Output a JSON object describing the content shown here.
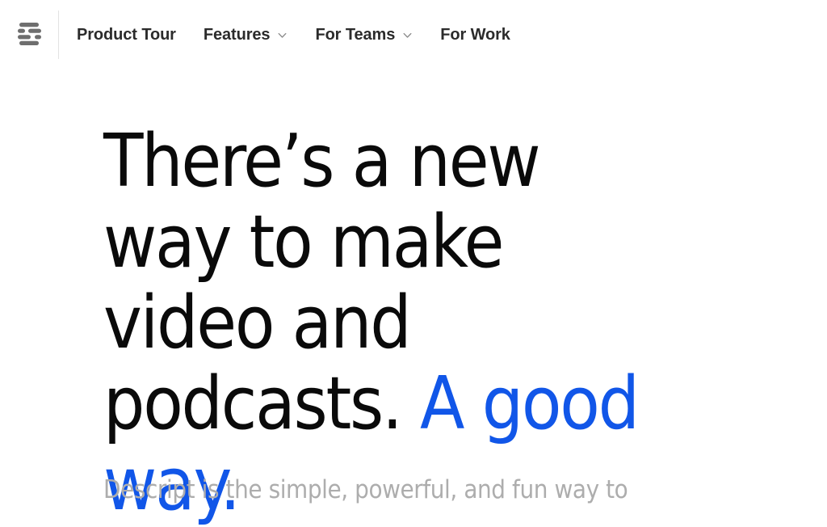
{
  "header": {
    "logo": {
      "icon": "descript-logo-icon",
      "alt": "Descript"
    },
    "nav_items": [
      {
        "label": "Product Tour",
        "has_dropdown": false
      },
      {
        "label": "Features",
        "has_dropdown": true
      },
      {
        "label": "For Teams",
        "has_dropdown": true
      },
      {
        "label": "For Work",
        "has_dropdown": false
      }
    ]
  },
  "hero": {
    "headline_part1": "There’s a new way to make video and podcasts. ",
    "headline_accent": "A good way.",
    "headline_full": "There’s a new way to make video and podcasts. A good way.",
    "subtitle": "Descript is the simple, powerful, and fun way to"
  },
  "colors": {
    "accent_blue": "#1156e8",
    "headline_black": "#0a0a0a",
    "subtitle_gray": "#adadad",
    "nav_text": "#2b2b2b",
    "divider": "#e3e3e3",
    "background": "#ffffff"
  }
}
